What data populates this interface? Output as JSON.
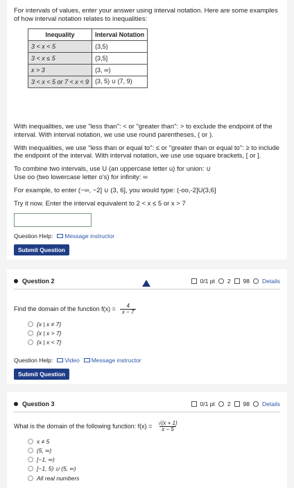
{
  "intro": {
    "text1": "For intervals of values, enter your answer using interval notation. Here are some examples of how interval notation relates to inequalities:",
    "table_headers": [
      "Inequality",
      "Interval Notation"
    ],
    "rows": [
      {
        "ineq": "3 < x < 5",
        "interval": "(3,5)"
      },
      {
        "ineq": "3 < x ≤ 5",
        "interval": "(3,5]"
      },
      {
        "ineq": "x > 3",
        "interval": "(3, ∞)"
      },
      {
        "ineq": "3 < x < 5 or 7 < x < 9",
        "interval": "(3, 5) ∪ (7, 9)"
      }
    ]
  },
  "section1": {
    "p1": "With inequalities, we use \"less than\": < or \"greater than\": > to exclude the endpoint of the interval. With interval notation, we use use round parentheses, ( or ).",
    "p2": "With inequalities, we use \"less than or equal to\": ≤ or \"greater than or equal to\": ≥ to include the endpoint of the interval. With interval notation, we use use square brackets, [ or ].",
    "p3": "To combine two intervals, use U (an uppercase letter u) for union: ∪",
    "p4": "Use oo (two lowercase letter o's) for infinity: ∞",
    "p5": "For example, to enter (−∞, −2] ∪ (3, 6], you would type: (-oo,-2]U(3,6]",
    "p6": "Try it now. Enter the interval equivalent to 2 < x ≤ 5 or x > 7",
    "help_label": "Question Help:",
    "message_instructor": "Message instructor",
    "submit": "Submit Question"
  },
  "question2": {
    "title": "Question 2",
    "score": "0/1 pt",
    "attempts": "2",
    "tries": "98",
    "details": "Details",
    "prompt": "Find the domain of the function f(x) =",
    "frac_num": "4",
    "frac_den": "x − 7",
    "choices": [
      "{x | x ≠ 7}",
      "{x | x > 7}",
      "{x | x < 7}"
    ],
    "help_label": "Question Help:",
    "video": "Video",
    "message_instructor": "Message instructor",
    "submit": "Submit Question"
  },
  "question3": {
    "title": "Question 3",
    "score": "0/1 pt",
    "attempts": "2",
    "tries": "98",
    "details": "Details",
    "prompt": "What is the domain of the following function: f(x) =",
    "frac_num": "√(x + 1)",
    "frac_den": "x − 5",
    "choices": [
      "x ≠ 5",
      "(5, ∞)",
      "[−1, ∞)",
      "[−1, 5) ∪ (5, ∞)",
      "All real numbers"
    ]
  }
}
